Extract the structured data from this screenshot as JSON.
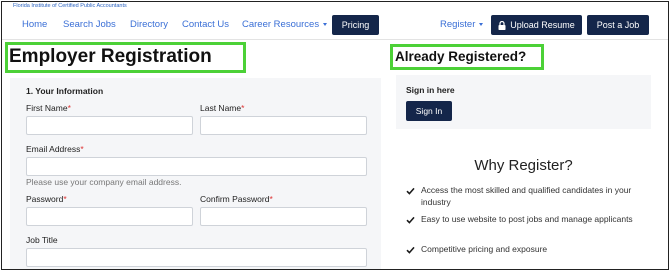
{
  "header": {
    "brand": "Florida Institute of Certified Public Accountants"
  },
  "nav": {
    "home": "Home",
    "search_jobs": "Search Jobs",
    "directory": "Directory",
    "contact_us": "Contact Us",
    "career_resources": "Career Resources",
    "pricing": "Pricing",
    "register": "Register",
    "upload_resume": "Upload Resume",
    "post_a_job": "Post a Job"
  },
  "page": {
    "title": "Employer Registration"
  },
  "form": {
    "section_title": "1. Your Information",
    "first_name_label": "First Name",
    "last_name_label": "Last Name",
    "email_label": "Email Address",
    "email_hint": "Please use your company email address.",
    "password_label": "Password",
    "confirm_password_label": "Confirm Password",
    "job_title_label": "Job Title",
    "required_marker": "*"
  },
  "signin": {
    "heading": "Already Registered?",
    "label": "Sign in here",
    "button": "Sign In"
  },
  "why": {
    "title": "Why Register?",
    "items": [
      "Access the most skilled and qualified candidates in your industry",
      "Easy to use website to post jobs and manage applicants",
      "Competitive pricing and exposure"
    ]
  },
  "colors": {
    "navy": "#14264a",
    "link": "#3a6fd6",
    "highlight": "#4cd137",
    "required": "#dd3333"
  },
  "icons": {
    "upload_resume": "lock-icon",
    "register": "chevron-down-icon",
    "career_resources": "chevron-down-icon",
    "why_items": "check-icon"
  }
}
